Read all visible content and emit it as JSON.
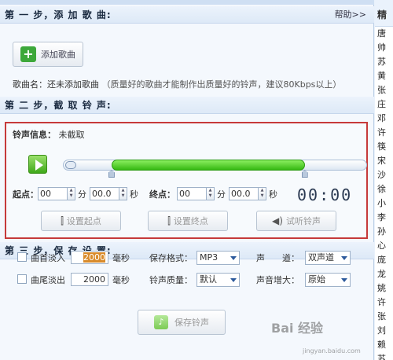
{
  "step1": {
    "title": "第 一 步，添 加 歌 曲:",
    "help": "帮助>>",
    "add_button": "添加歌曲",
    "song_label": "歌曲名：还未添加歌曲",
    "hint": "（质量好的歌曲才能制作出质量好的铃声，建议80Kbps以上）"
  },
  "step2": {
    "title": "第 二 步，截 取 铃 声:",
    "info_label": "铃声信息：",
    "info_value": "未截取",
    "selection_start_fraction": 0.16,
    "selection_end_fraction": 0.795,
    "start_label": "起点：",
    "start_min": "00",
    "min_unit": "分",
    "start_sec": "00.0",
    "sec_unit": "秒",
    "end_label": "终点：",
    "end_min": "00",
    "end_sec": "00.0",
    "clock": "00:00",
    "set_start": "设置起点",
    "set_end": "设置终点",
    "preview": "试听铃声"
  },
  "step3": {
    "title": "第 三 步，保 存 设 置:",
    "fade_in_label": "曲首淡入",
    "fade_in_value": "2000",
    "fade_out_label": "曲尾淡出",
    "fade_out_value": "2000",
    "ms_unit": "毫秒",
    "format_label": "保存格式：",
    "format_value": "MP3",
    "channel_label": "声　　道：",
    "channel_value": "双声道",
    "quality_label": "铃声质量：",
    "quality_value": "默认",
    "volume_label": "声音增大：",
    "volume_value": "原始",
    "save_button": "保存铃声"
  },
  "sidebar": {
    "header": "精",
    "items": [
      "唐",
      "帅",
      "苏",
      "黄",
      "张",
      "庄",
      "邓",
      "许",
      "筷",
      "宋",
      "沙",
      "徐",
      "小",
      "李",
      "孙",
      "心",
      "庞",
      "龙",
      "姚",
      "许",
      "张",
      "刘",
      "赖",
      "苏"
    ]
  },
  "watermark": {
    "text": "Bai 经验",
    "sub": "jingyan.baidu.com"
  },
  "colors": {
    "accent_green": "#3da83a",
    "highlight_red": "#c63a3a",
    "header_bg": "#dde9f7"
  }
}
